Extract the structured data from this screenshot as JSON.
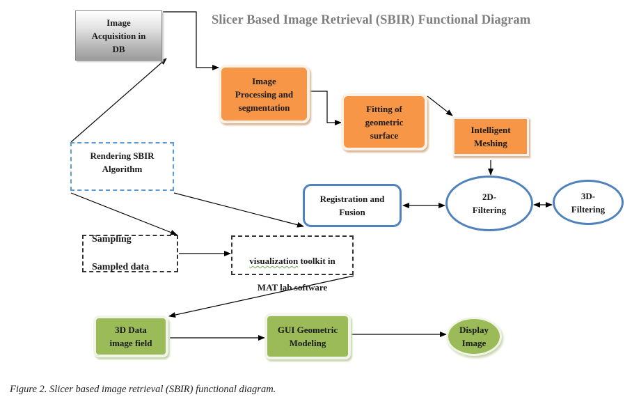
{
  "diagram": {
    "title": "Slicer Based Image Retrieval (SBIR) Functional Diagram",
    "caption": "Figure 2. Slicer based image retrieval (SBIR) functional diagram.",
    "colors": {
      "title_gray": "#7f7f7f",
      "orange_fill": "#f79646",
      "green_fill": "#9bbb59",
      "blue_border": "#4f81bd",
      "blue_dashed": "#5b9bd5",
      "gray_gradient_dark": "#9c9c9c"
    },
    "nodes": {
      "image_acquisition": "Image\nAcquisition in\nDB",
      "image_processing": "Image\nProcessing and\nsegmentation",
      "fitting": "Fitting of\ngeometric\nsurface",
      "meshing": "Intelligent\nMeshing",
      "rendering": "Rendering SBIR\nAlgorithm",
      "registration": "Registration and\nFusion",
      "filtering_2d": "2D-\nFiltering",
      "filtering_3d": "3D-\nFiltering",
      "sampling_line1": "Sampling",
      "sampling_line2": "Sampled data",
      "viz_word": "visualization",
      "viz_rest_line1": " toolkit in",
      "viz_line2": "MAT lab software",
      "data_3d": "3D Data\nimage field",
      "gui_modeling": "GUI Geometric\nModeling",
      "display_image": "Display\nImage"
    },
    "edges": [
      {
        "from": "image_acquisition",
        "to": "image_processing",
        "type": "elbow-arrow"
      },
      {
        "from": "image_processing",
        "to": "fitting",
        "type": "elbow-arrow"
      },
      {
        "from": "fitting",
        "to": "meshing",
        "type": "arrow"
      },
      {
        "from": "meshing",
        "to": "filtering_2d",
        "type": "arrow"
      },
      {
        "from": "rendering",
        "to": "image_acquisition",
        "type": "arrow"
      },
      {
        "from": "rendering",
        "to": "sampling",
        "type": "arrow"
      },
      {
        "from": "rendering",
        "to": "registration",
        "type": "arrow"
      },
      {
        "from": "registration",
        "to": "filtering_2d",
        "type": "bidirectional"
      },
      {
        "from": "filtering_2d",
        "to": "filtering_3d",
        "type": "bidirectional"
      },
      {
        "from": "sampling",
        "to": "visualization",
        "type": "arrow"
      },
      {
        "from": "visualization",
        "to": "data_3d",
        "type": "arrow"
      },
      {
        "from": "data_3d",
        "to": "gui_modeling",
        "type": "arrow"
      },
      {
        "from": "gui_modeling",
        "to": "display_image",
        "type": "arrow"
      }
    ]
  }
}
